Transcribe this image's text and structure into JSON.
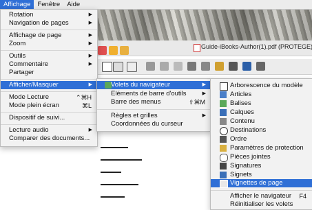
{
  "menubar": {
    "items": [
      "Affichage",
      "Fenêtre",
      "Aide"
    ]
  },
  "window": {
    "title": "Guide-iBooks-Author(1).pdf (PROTEGE)"
  },
  "menu_affichage": {
    "rotation": "Rotation",
    "navigation": "Navigation de pages",
    "affichage_page": "Affichage de page",
    "zoom": "Zoom",
    "outils": "Outils",
    "commentaire": "Commentaire",
    "partager": "Partager",
    "afficher_masquer": "Afficher/Masquer",
    "mode_lecture": "Mode Lecture",
    "mode_lecture_sc": "⌃⌘H",
    "plein_ecran": "Mode plein écran",
    "plein_ecran_sc": "⌘L",
    "suivi": "Dispositif de suivi...",
    "lecture_audio": "Lecture audio",
    "comparer": "Comparer des documents..."
  },
  "menu_afficher": {
    "volets": "Volets du navigateur",
    "elements": "Eléments de barre d'outils",
    "barre_menus": "Barre des menus",
    "barre_menus_sc": "⇧⌘M",
    "regles": "Règles et grilles",
    "coordonnees": "Coordonnées du curseur"
  },
  "menu_volets": {
    "arborescence": "Arborescence du modèle",
    "articles": "Articles",
    "balises": "Balises",
    "calques": "Calques",
    "contenu": "Contenu",
    "destinations": "Destinations",
    "ordre": "Ordre",
    "parametres": "Paramètres de protection",
    "pieces": "Pièces jointes",
    "signatures": "Signatures",
    "signets": "Signets",
    "vignettes": "Vignettes de page",
    "afficher_nav": "Afficher le navigateur",
    "afficher_nav_sc": "F4",
    "reinit": "Réinitialiser les volets"
  },
  "colors": {
    "highlight": "#2f6fd6",
    "menu_bg": "#f2f2f2"
  }
}
